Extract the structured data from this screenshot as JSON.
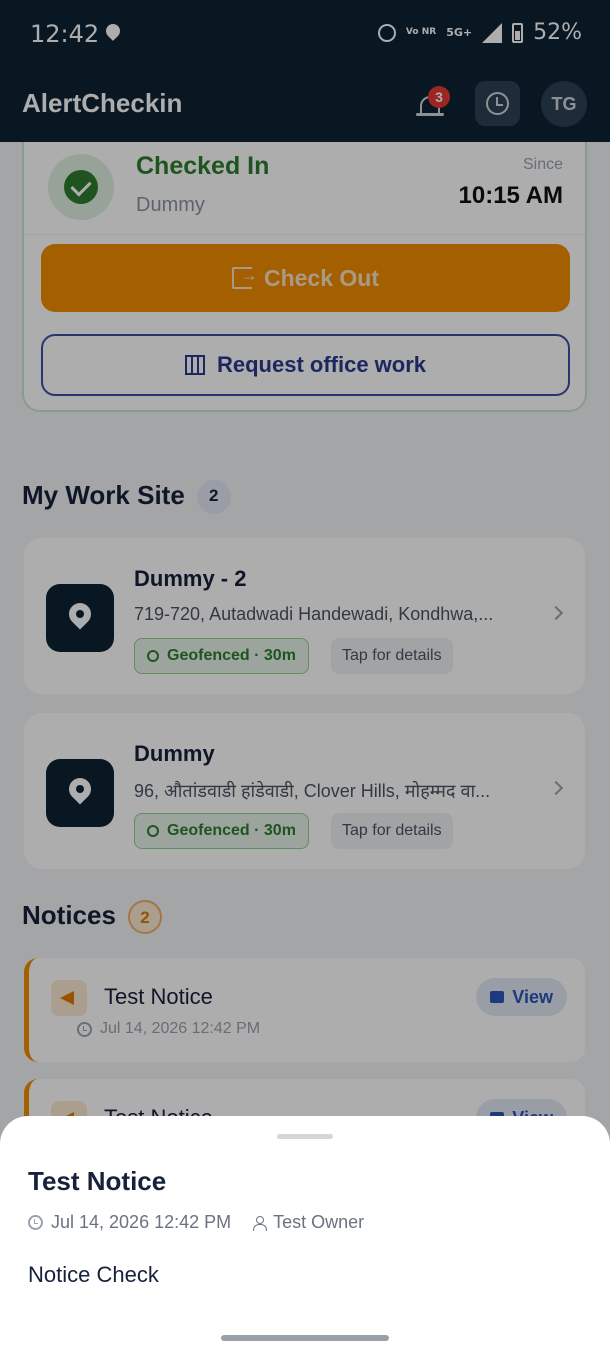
{
  "status_bar": {
    "time": "12:42",
    "network": "5G+",
    "volte": "Vo NR",
    "battery": "52%"
  },
  "app_bar": {
    "title": "AlertCheckin",
    "notification_count": "3",
    "avatar_initials": "TG"
  },
  "checkin": {
    "status": "Checked In",
    "site": "Dummy",
    "since_label": "Since",
    "since_time": "10:15 AM",
    "checkout_label": "Check Out",
    "request_label": "Request office work"
  },
  "work_sites": {
    "title": "My Work Site",
    "count": "2",
    "items": [
      {
        "name": "Dummy - 2",
        "address": "719-720, Autadwadi Handewadi, Kondhwa,...",
        "geo": "Geofenced · 30m",
        "tap": "Tap for details"
      },
      {
        "name": "Dummy",
        "address": "96, औतांडवाडी हांडेवाडी, Clover Hills, मोहम्मद वा...",
        "geo": "Geofenced · 30m",
        "tap": "Tap for details"
      }
    ]
  },
  "notices": {
    "title": "Notices",
    "count": "2",
    "items": [
      {
        "title": "Test Notice",
        "date": "Jul 14, 2026 12:42 PM",
        "view": "View"
      },
      {
        "title": "Test Notice",
        "date": "",
        "view": "View"
      }
    ]
  },
  "sheet": {
    "title": "Test Notice",
    "date": "Jul 14, 2026 12:42 PM",
    "owner": "Test Owner",
    "body": "Notice Check"
  },
  "colors": {
    "primary_dark": "#0c2233",
    "accent_orange": "#f08c00",
    "success_green": "#2e7d32",
    "indigo": "#2a3a8c"
  }
}
